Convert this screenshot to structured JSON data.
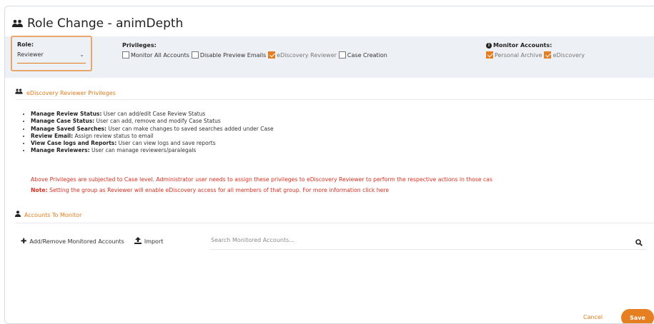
{
  "dialog": {
    "title": "Role Change - animDepth",
    "title_icon": "users-icon"
  },
  "role": {
    "label": "Role:",
    "value": "Reviewer"
  },
  "privileges": {
    "label": "Privileges:",
    "options": [
      {
        "label": "Monitor All Accounts",
        "checked": false
      },
      {
        "label": "Disable Preview Emails",
        "checked": false
      },
      {
        "label": "eDiscovery Reviewer",
        "checked": true
      },
      {
        "label": "Case Creation",
        "checked": false
      }
    ]
  },
  "monitor_accounts": {
    "label": "Monitor Accounts:",
    "options": [
      {
        "label": "Personal Archive",
        "checked": true
      },
      {
        "label": "eDiscovery",
        "checked": true
      }
    ]
  },
  "ediscovery_section": {
    "title": "eDiscovery Reviewer Privileges",
    "items": [
      {
        "name": "Manage Review Status:",
        "desc": " User can add/edit Case Review Status"
      },
      {
        "name": "Manage Case Status:",
        "desc": " User can add, remove and modify Case Status"
      },
      {
        "name": "Manage Saved Searches:",
        "desc": " User can make changes to saved searches added under Case"
      },
      {
        "name": "Review Email:",
        "desc": " Assign review status to email"
      },
      {
        "name": "View Case logs and Reports:",
        "desc": " User can view logs and save reports"
      },
      {
        "name": "Manage Reviewers:",
        "desc": " User can manage reviewers/paralegals"
      }
    ],
    "notice": "Above Privileges are subjected to Case level. Administrator user needs to assign these privileges to eDiscovery Reviewer to perform the respective actions in those cas",
    "note_label": "Note:",
    "note_text": " Setting the group as Reviewer will enable eDiscovery access for all members of that group. For more information click here"
  },
  "accounts_section": {
    "title": "Accounts To Monitor",
    "add_remove_label": "Add/Remove Monitored Accounts",
    "import_label": "Import",
    "search_placeholder": "Search Monitored Accounts..."
  },
  "footer": {
    "cancel_label": "Cancel",
    "save_label": "Save"
  },
  "colors": {
    "accent": "#e67e22",
    "warning_text": "#d9301f",
    "band": "#edf0f4"
  }
}
